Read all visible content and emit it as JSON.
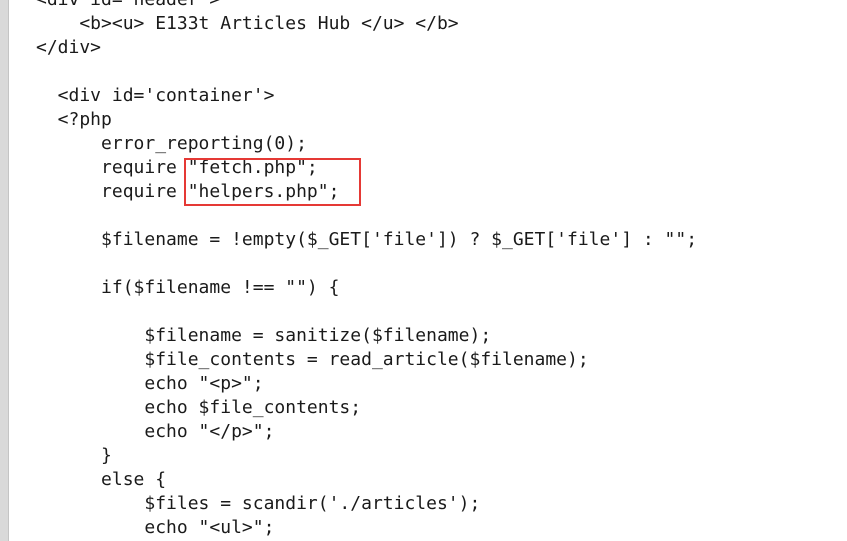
{
  "lines": [
    "<div id='header'>",
    "    <b><u> E133t Articles Hub </u> </b>",
    "</div>",
    "",
    "  <div id='container'>",
    "  <?php",
    "      error_reporting(0);",
    "      require \"fetch.php\";",
    "      require \"helpers.php\";",
    "",
    "      $filename = !empty($_GET['file']) ? $_GET['file'] : \"\";",
    "",
    "      if($filename !== \"\") {",
    "",
    "          $filename = sanitize($filename);",
    "          $file_contents = read_article($filename);",
    "          echo \"<p>\";",
    "          echo $file_contents;",
    "          echo \"</p>\";",
    "      }",
    "      else {",
    "          $files = scandir('./articles');",
    "          echo \"<ul>\";"
  ],
  "highlight": {
    "color": "#e53935",
    "label": "require statements highlight"
  }
}
